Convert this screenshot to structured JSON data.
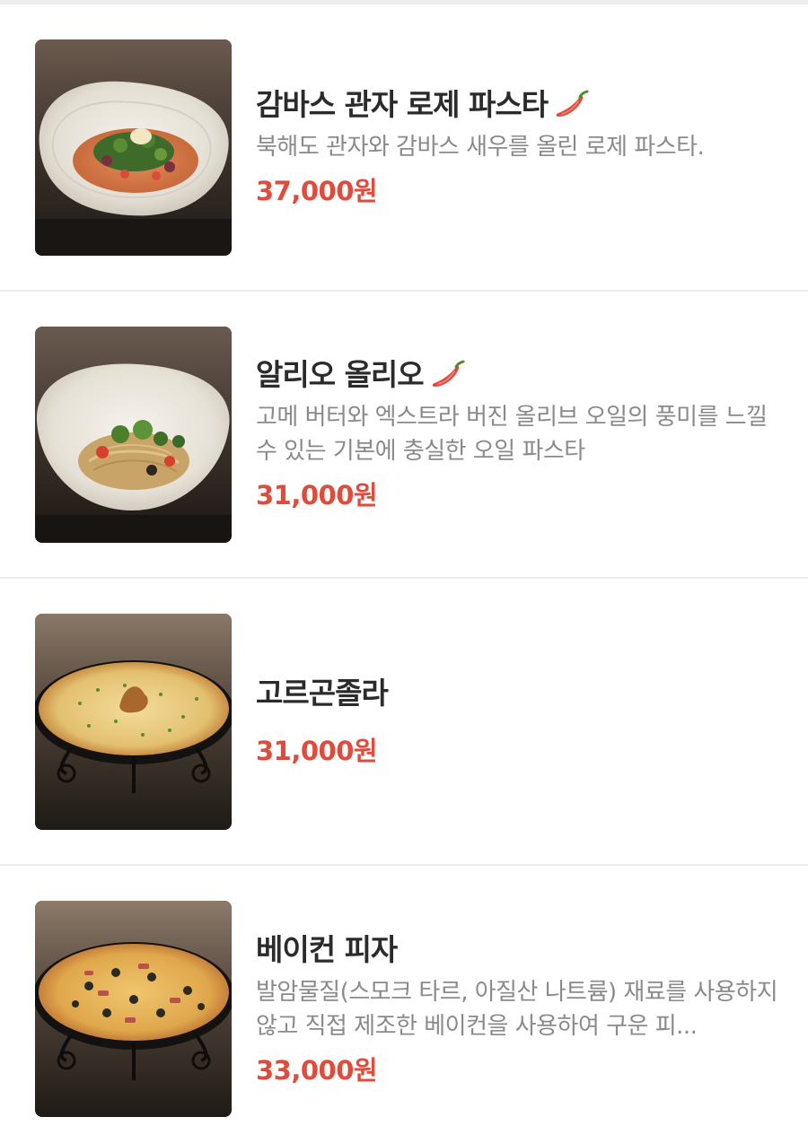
{
  "colors": {
    "price": "#e04b3c",
    "title": "#2b2b2b",
    "description": "#8a8a8a",
    "divider": "#ececec",
    "spicy": "#e04b3c"
  },
  "items": [
    {
      "name": "감바스 관자 로제 파스타",
      "spicy": true,
      "icon": "chili-pepper-icon",
      "description": "북해도 관자와 감바스 새우를 올린 로제 파스타.",
      "price": "37,000원",
      "image": "rose-pasta-photo"
    },
    {
      "name": "알리오 올리오",
      "spicy": true,
      "icon": "chili-pepper-icon",
      "description": "고메 버터와 엑스트라 버진 올리브 오일의 풍미를 느낄 수 있는 기본에 충실한 오일 파스타",
      "price": "31,000원",
      "image": "aglio-olio-photo"
    },
    {
      "name": "고르곤졸라",
      "spicy": false,
      "description": "",
      "price": "31,000원",
      "image": "gorgonzola-pizza-photo"
    },
    {
      "name": "베이컨 피자",
      "spicy": false,
      "description": "발암물질(스모크 타르, 아질산 나트륨) 재료를 사용하지 않고 직접 제조한 베이컨을 사용하여 구운 피...",
      "price": "33,000원",
      "image": "bacon-pizza-photo"
    }
  ]
}
